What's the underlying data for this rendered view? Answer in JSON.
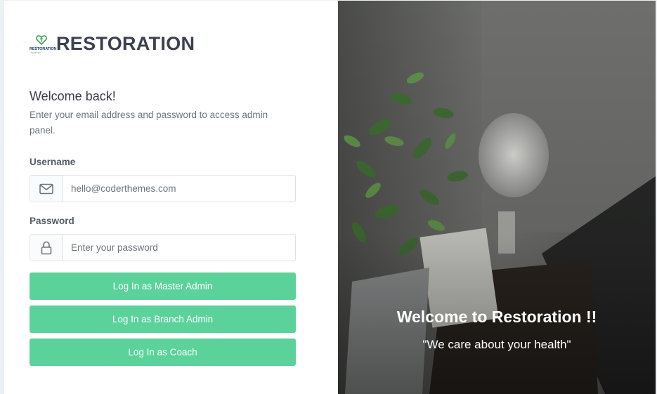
{
  "brand": {
    "name": "RESTORATION",
    "logo_text": "RESTORATION",
    "logo_subtext": "healthcare",
    "accent_color": "#5cd29b"
  },
  "login": {
    "title": "Welcome back!",
    "subtitle": "Enter your email address and password to access admin panel.",
    "username_label": "Username",
    "username_value": "hello@coderthemes.com",
    "username_icon": "mail-icon",
    "password_label": "Password",
    "password_placeholder": "Enter your password",
    "password_icon": "lock-icon",
    "buttons": {
      "master_admin": "Log In as Master Admin",
      "branch_admin": "Log In as Branch Admin",
      "coach": "Log In as Coach"
    }
  },
  "hero": {
    "title": "Welcome to Restoration !!",
    "subtitle": "\"We care about your health\""
  }
}
